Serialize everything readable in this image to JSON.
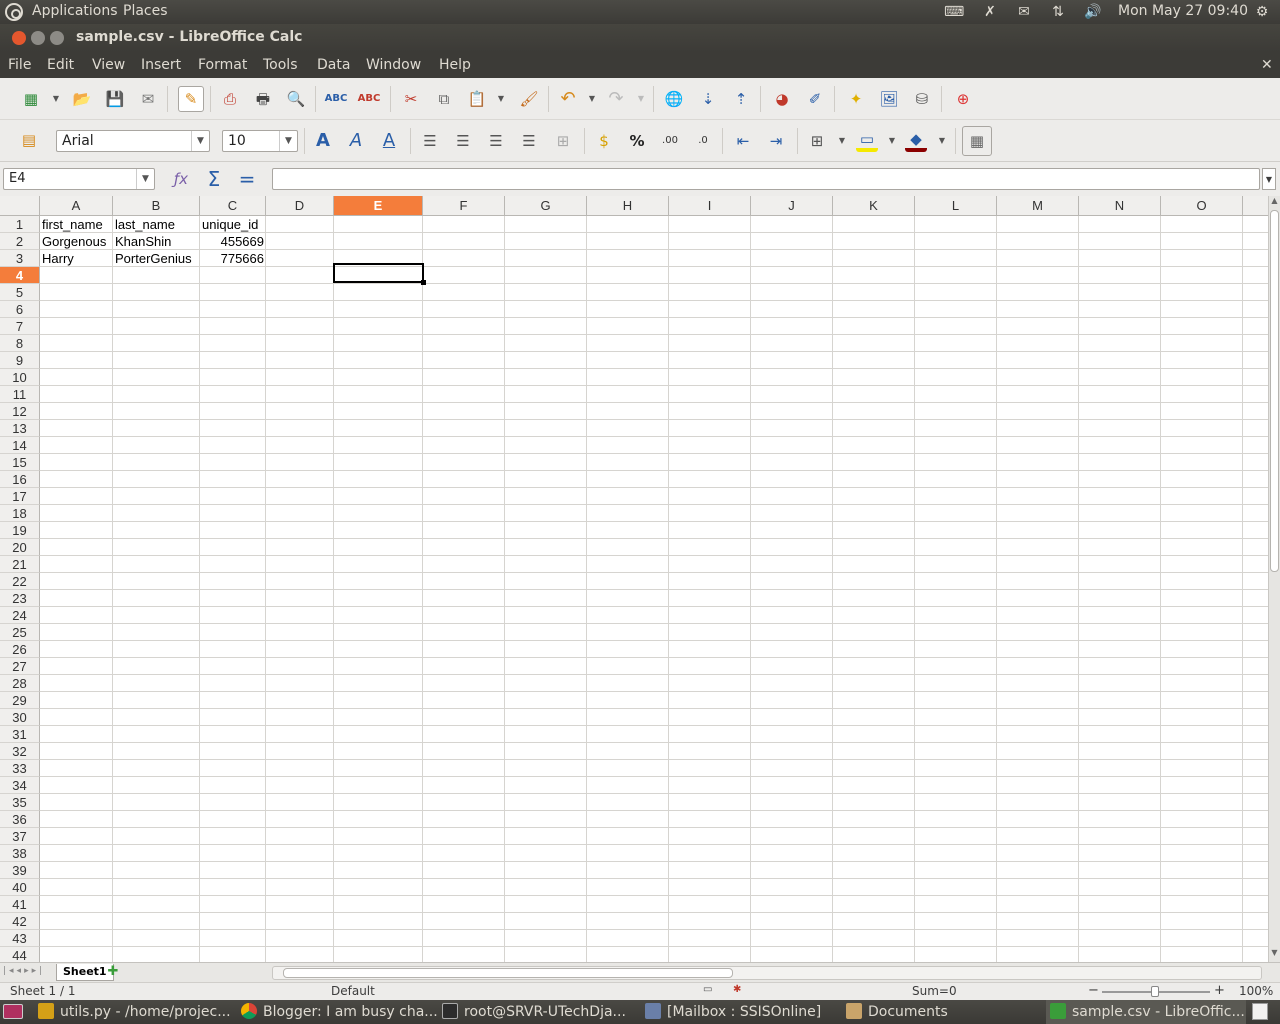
{
  "top_panel": {
    "applications": "Applications",
    "places": "Places",
    "clock": "Mon May 27  09:40"
  },
  "window": {
    "title": "sample.csv - LibreOffice Calc"
  },
  "menu": [
    "File",
    "Edit",
    "View",
    "Insert",
    "Format",
    "Tools",
    "Data",
    "Window",
    "Help"
  ],
  "formatting": {
    "font_name": "Arial",
    "font_size": "10"
  },
  "formula_bar": {
    "name_box": "E4",
    "input": ""
  },
  "columns": [
    "A",
    "B",
    "C",
    "D",
    "E",
    "F",
    "G",
    "H",
    "I",
    "J",
    "K",
    "L",
    "M",
    "N",
    "O"
  ],
  "selected_cell": {
    "column": "E",
    "row": 4
  },
  "rows": [
    "1",
    "2",
    "3",
    "4",
    "5",
    "6",
    "7",
    "8",
    "9",
    "10",
    "11",
    "12",
    "13",
    "14",
    "15",
    "16",
    "17",
    "18",
    "19",
    "20",
    "21",
    "22",
    "23",
    "24",
    "25",
    "26",
    "27",
    "28",
    "29",
    "30",
    "31",
    "32",
    "33",
    "34",
    "35",
    "36",
    "37",
    "38",
    "39",
    "40",
    "41",
    "42",
    "43",
    "44"
  ],
  "cells": {
    "A1": "first_name",
    "B1": "last_name",
    "C1": "unique_id",
    "A2": "Gorgenous",
    "B2": "KhanShin",
    "C2": "455669",
    "A3": "Harry",
    "B3": "PorterGenius",
    "C3": "775666"
  },
  "sheet_tabs": [
    "Sheet1"
  ],
  "status": {
    "sheet": "Sheet 1 / 1",
    "page_style": "Default",
    "sum": "Sum=0",
    "zoom": "100%"
  },
  "taskbar": [
    {
      "label": "utils.py - /home/projec...",
      "icon": "python-editor-icon"
    },
    {
      "label": "Blogger: I am busy cha...",
      "icon": "chrome-icon"
    },
    {
      "label": "root@SRVR-UTechDja...",
      "icon": "terminal-icon"
    },
    {
      "label": "[Mailbox : SSISOnline]",
      "icon": "mail-client-icon"
    },
    {
      "label": "Documents",
      "icon": "folder-icon"
    },
    {
      "label": "sample.csv - LibreOffic...",
      "icon": "calc-icon"
    }
  ],
  "colors": {
    "accent_selected_header": "#f47d3b",
    "panel_bg": "#3c3b37",
    "close_button": "#e4572e"
  }
}
